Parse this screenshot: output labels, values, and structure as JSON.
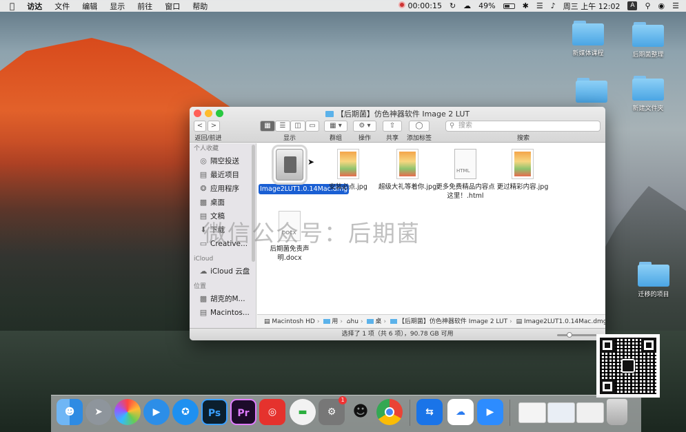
{
  "menubar": {
    "apple": "",
    "items": [
      "访达",
      "文件",
      "编辑",
      "显示",
      "前往",
      "窗口",
      "帮助"
    ],
    "record_time": "00:00:15",
    "battery": "49%",
    "clock": "周三 上午 12:02",
    "input_method": "A"
  },
  "desktop_icons": [
    {
      "label": "新媒体课程"
    },
    {
      "label": "后期菌整理"
    },
    {
      "label": "新建文件夹"
    },
    {
      "label": "迁移的项目"
    }
  ],
  "finder": {
    "title": "【后期菌】仿色神器软件 Image 2 LUT",
    "toolbar": {
      "back_label": "<",
      "forward_label": ">",
      "nav_caption": "返回/前进",
      "view_caption": "显示",
      "group_caption": "群组",
      "action_caption": "操作",
      "share_caption": "共享",
      "tag_caption": "添加标签",
      "search_placeholder": "搜索",
      "search_caption": "搜索"
    },
    "sidebar": {
      "section_favorites": "个人收藏",
      "favorites": [
        {
          "label": "隔空投送",
          "icon": "airdrop-icon"
        },
        {
          "label": "最近项目",
          "icon": "recents-icon"
        },
        {
          "label": "应用程序",
          "icon": "applications-icon"
        },
        {
          "label": "桌面",
          "icon": "desktop-icon"
        },
        {
          "label": "文稿",
          "icon": "documents-icon"
        },
        {
          "label": "下载",
          "icon": "downloads-icon"
        },
        {
          "label": "Creative...",
          "icon": "folder-icon"
        }
      ],
      "section_icloud": "iCloud",
      "icloud": [
        {
          "label": "iCloud 云盘",
          "icon": "cloud-icon"
        }
      ],
      "section_locations": "位置",
      "locations": [
        {
          "label": "胡克的M...",
          "icon": "computer-icon"
        },
        {
          "label": "Macintos...",
          "icon": "disk-icon"
        }
      ]
    },
    "files": [
      {
        "name": "Image2LUT1.0.14Mac.dmg",
        "type": "dmg",
        "selected": true
      },
      {
        "name": "安装必点.jpg",
        "type": "jpg"
      },
      {
        "name": "超级大礼等着你.jpg",
        "type": "jpg"
      },
      {
        "name": "更多免费精品内容点这里！.html",
        "type": "html"
      },
      {
        "name": "更过精彩内容.jpg",
        "type": "jpg"
      },
      {
        "name": "后期菌免责声明.docx",
        "type": "docx"
      }
    ],
    "pathbar": [
      "Macintosh HD",
      "用",
      "hu",
      "桌",
      "【后期菌】仿色神器软件 Image 2 LUT",
      "Image2LUT1.0.14Mac.dmg"
    ],
    "status": "选择了 1 项（共 6 项），90.78 GB 可用"
  },
  "watermark": "微信公众号：后期菌",
  "dock": {
    "badge_count": "1",
    "apps": [
      {
        "name": "finder-icon",
        "label": ""
      },
      {
        "name": "launchpad-icon",
        "label": ""
      },
      {
        "name": "photos-icon",
        "label": ""
      },
      {
        "name": "music-player-icon",
        "label": ""
      },
      {
        "name": "safari-icon",
        "label": ""
      },
      {
        "name": "photoshop-icon",
        "label": "Ps"
      },
      {
        "name": "premiere-icon",
        "label": "Pr"
      },
      {
        "name": "netease-music-icon",
        "label": ""
      },
      {
        "name": "wechat-app-icon",
        "label": ""
      },
      {
        "name": "system-preferences-icon",
        "label": ""
      },
      {
        "name": "qq-icon",
        "label": ""
      },
      {
        "name": "chrome-icon",
        "label": ""
      },
      {
        "name": "teamviewer-icon",
        "label": ""
      },
      {
        "name": "baidu-netdisk-icon",
        "label": ""
      },
      {
        "name": "zoom-icon",
        "label": ""
      }
    ]
  }
}
